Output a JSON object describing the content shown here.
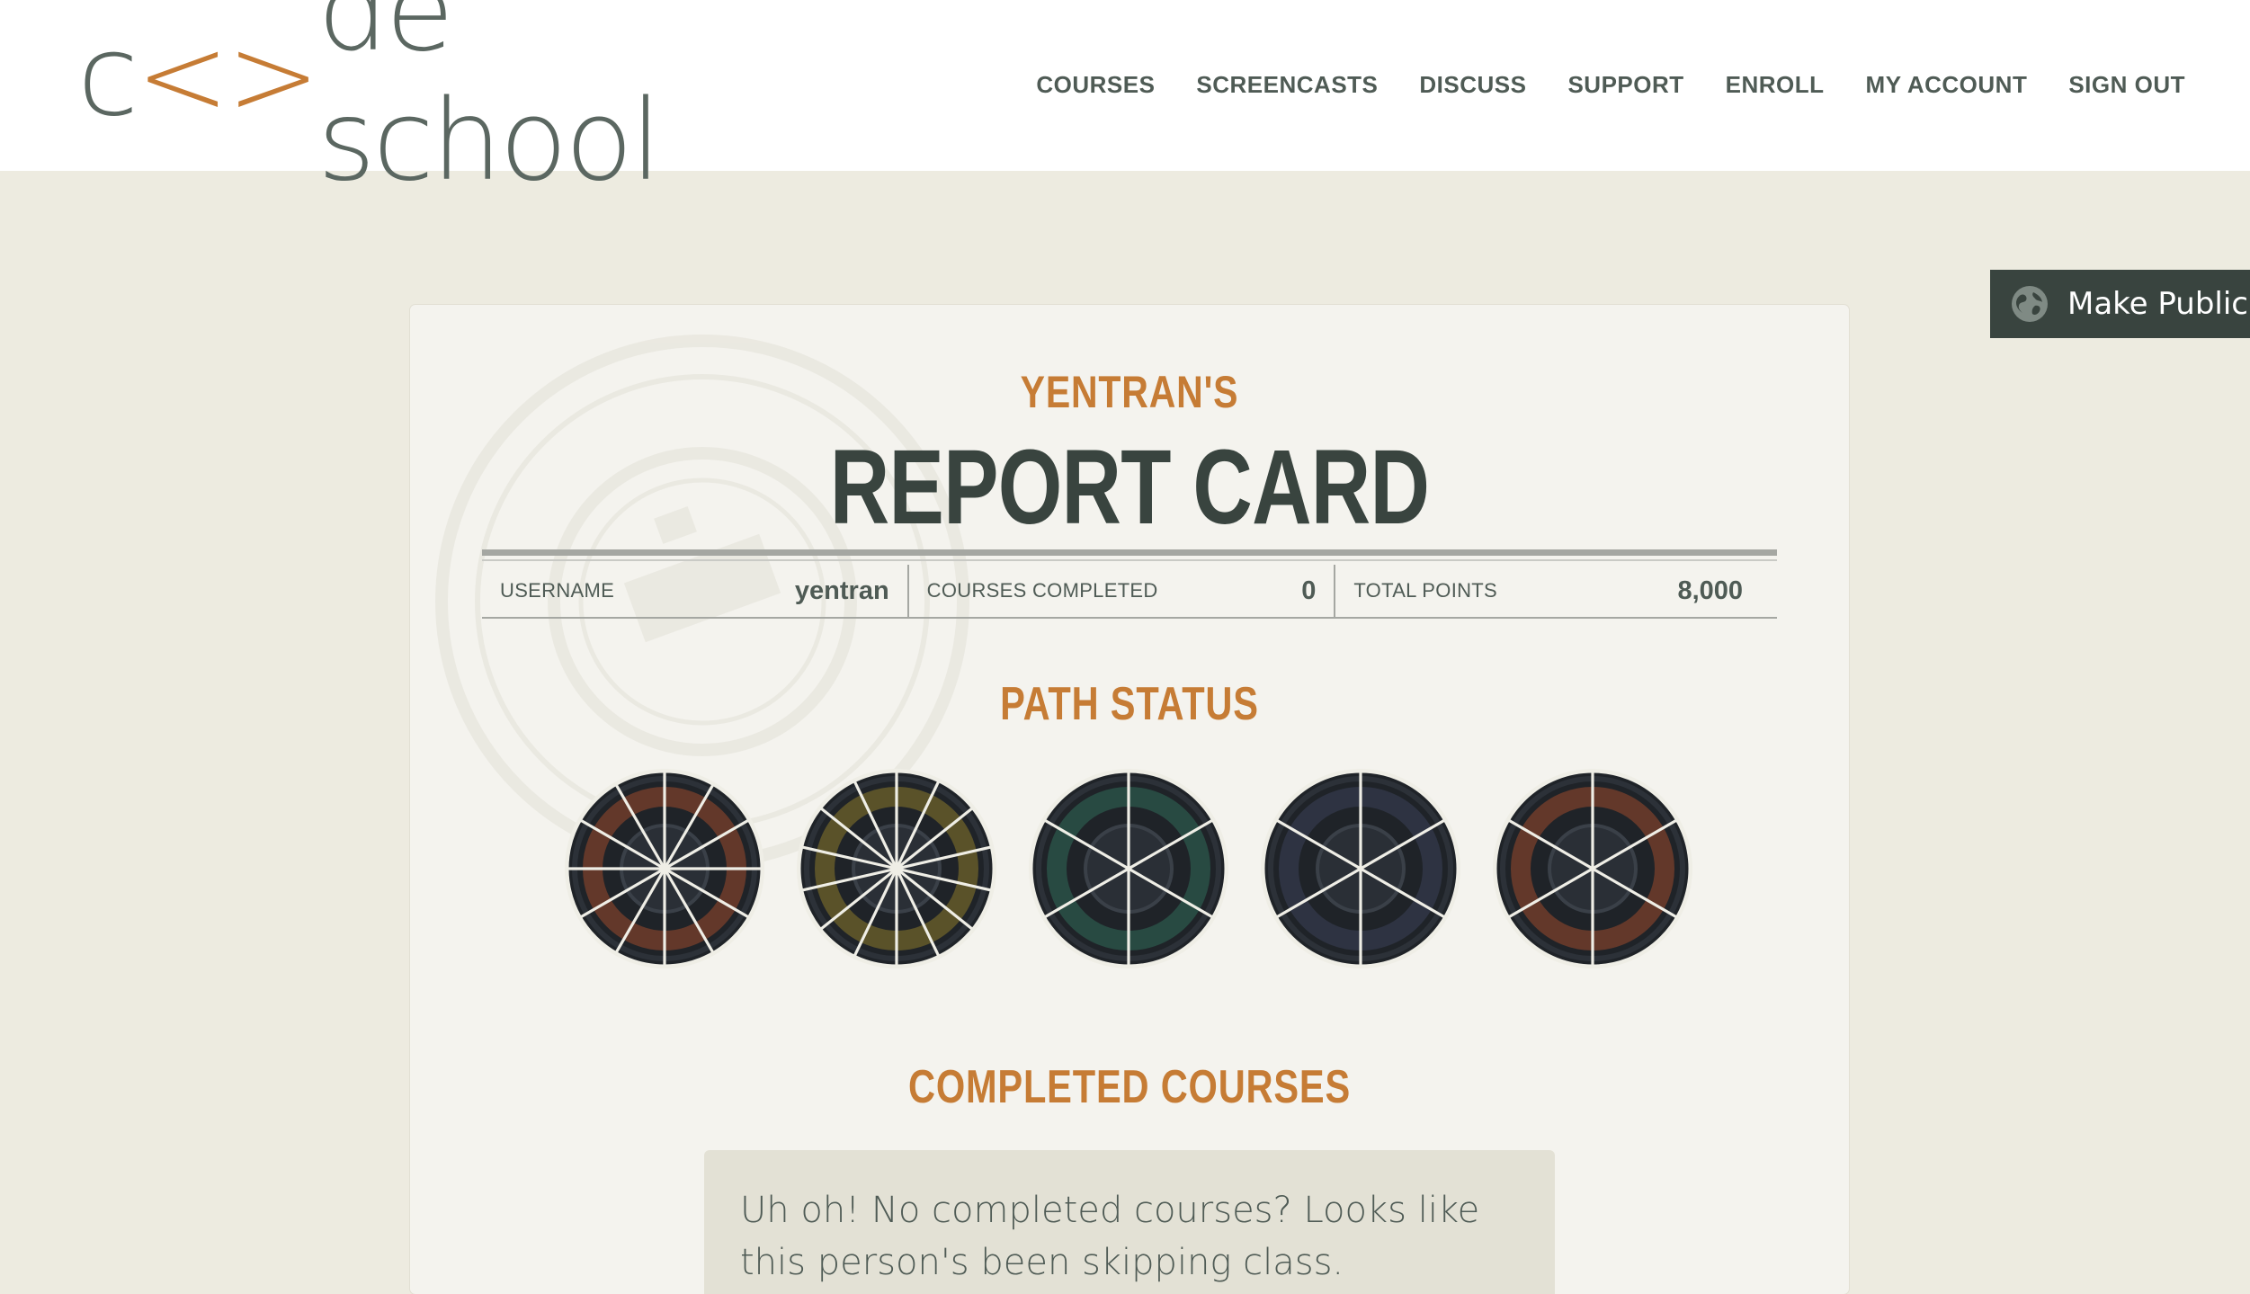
{
  "header": {
    "logo": {
      "part1": "c",
      "chevron_left": "<",
      "chevron_right": ">",
      "part2": "de school"
    },
    "nav": [
      {
        "label": "COURSES"
      },
      {
        "label": "SCREENCASTS"
      },
      {
        "label": "DISCUSS"
      },
      {
        "label": "SUPPORT"
      },
      {
        "label": "ENROLL"
      },
      {
        "label": "MY ACCOUNT"
      },
      {
        "label": "SIGN OUT"
      }
    ]
  },
  "make_public": {
    "label": "Make Public",
    "icon": "globe-icon"
  },
  "report_card": {
    "owner": "YENTRAN'S",
    "title": "REPORT CARD",
    "stats": {
      "username_label": "USERNAME",
      "username_value": "yentran",
      "courses_completed_label": "COURSES COMPLETED",
      "courses_completed_value": "0",
      "total_points_label": "TOTAL POINTS",
      "total_points_value": "8,000"
    },
    "path_status_title": "PATH STATUS",
    "paths": [
      {
        "name": "ruby-path",
        "segments": 12,
        "accent": "#9a4a2c"
      },
      {
        "name": "javascript-path",
        "segments": 14,
        "accent": "#8a7a2a"
      },
      {
        "name": "html-css-path",
        "segments": 6,
        "accent": "#2f6b57"
      },
      {
        "name": "ios-path",
        "segments": 6,
        "accent": "#3a4258"
      },
      {
        "name": "electives-path",
        "segments": 6,
        "accent": "#9a4a2c"
      }
    ],
    "completed_title": "COMPLETED COURSES",
    "empty_message": "Uh oh! No completed courses? Looks like this person's been skipping class."
  },
  "colors": {
    "accent_orange": "#c67c35",
    "dark_slate": "#39443f",
    "page_bg": "#edebe0",
    "card_bg": "#f4f3ee"
  }
}
